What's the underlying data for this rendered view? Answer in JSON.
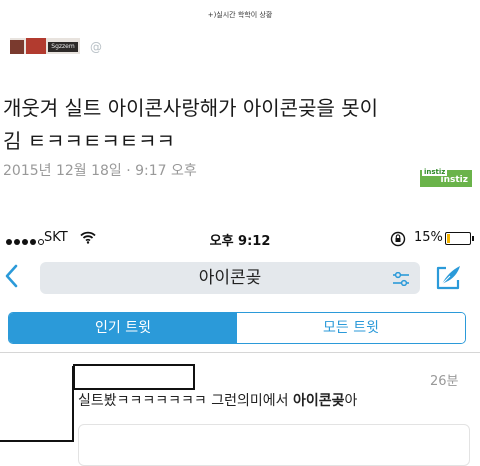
{
  "caption": "+)실시간 학학이 상황",
  "tweet": {
    "handle": "@",
    "avatar_text": "Sgzzem",
    "text_line1": "개웃겨 실트 아이콘사랑해가  아이콘곶을 못이",
    "text_line2": "김 ㅌㅋㅋㅌㅋㅌㅋㅋ",
    "date": "2015년 12월 18일 · 9:17 오후"
  },
  "watermark": {
    "small": "instiz",
    "large": "instiz"
  },
  "status_bar": {
    "carrier": "SKT",
    "time": "오후 9:12",
    "battery_percent_text": "15%",
    "battery_level": 0.15,
    "signal_bars_filled": 4,
    "signal_bars_total": 5
  },
  "search": {
    "query": "아이콘곶"
  },
  "tabs": {
    "top": "인기 트윗",
    "all": "모든 트윗"
  },
  "result": {
    "time": "26분",
    "text_before": "실트봤ㅋㅋㅋㅋㅋㅋㅋ 그런의미에서 ",
    "text_bold": "아이콘곶",
    "text_after": "아"
  },
  "icons": {
    "back": "chevron-left-icon",
    "filter": "sliders-icon",
    "compose": "compose-feather-icon",
    "wifi": "wifi-icon",
    "lock": "rotation-lock-icon",
    "battery": "battery-icon"
  },
  "colors": {
    "accent": "#2b9ad9",
    "battery_fill": "#f5b400",
    "watermark_bg": "#6ab34a",
    "muted_text": "#999999"
  }
}
